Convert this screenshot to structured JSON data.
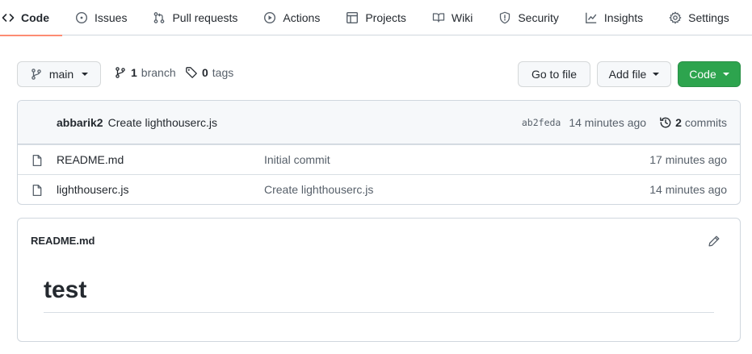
{
  "nav": {
    "tabs": [
      {
        "label": "Code",
        "icon": "code-icon",
        "active": true
      },
      {
        "label": "Issues",
        "icon": "issue-opened-icon",
        "active": false
      },
      {
        "label": "Pull requests",
        "icon": "git-pull-request-icon",
        "active": false
      },
      {
        "label": "Actions",
        "icon": "play-icon",
        "active": false
      },
      {
        "label": "Projects",
        "icon": "table-icon",
        "active": false
      },
      {
        "label": "Wiki",
        "icon": "book-icon",
        "active": false
      },
      {
        "label": "Security",
        "icon": "shield-icon",
        "active": false
      },
      {
        "label": "Insights",
        "icon": "graph-icon",
        "active": false
      },
      {
        "label": "Settings",
        "icon": "gear-icon",
        "active": false
      }
    ],
    "active_underline_color": "#fd8c73"
  },
  "toolbar": {
    "branch_select": "main",
    "branches": {
      "count": "1",
      "label": "branch"
    },
    "tags": {
      "count": "0",
      "label": "tags"
    },
    "go_to_file": "Go to file",
    "add_file": "Add file",
    "code_button": "Code",
    "code_button_color": "#2da44e"
  },
  "latest_commit": {
    "author": "abbarik2",
    "message": "Create lighthouserc.js",
    "sha": "ab2feda",
    "age": "14 minutes ago",
    "commits_count": "2",
    "commits_label": "commits"
  },
  "files": [
    {
      "name": "README.md",
      "message": "Initial commit",
      "age": "17 minutes ago",
      "icon": "file-icon"
    },
    {
      "name": "lighthouserc.js",
      "message": "Create lighthouserc.js",
      "age": "14 minutes ago",
      "icon": "file-icon"
    }
  ],
  "readme": {
    "title": "README.md",
    "heading": "test"
  }
}
